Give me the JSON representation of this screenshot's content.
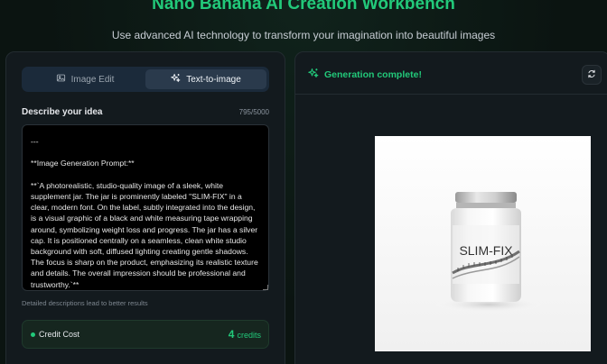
{
  "header": {
    "title": "Nano Banana AI Creation Workbench",
    "subtitle": "Use advanced AI technology to transform your imagination into beautiful images"
  },
  "tabs": [
    {
      "label": "Image Edit",
      "icon": "image-icon",
      "active": false
    },
    {
      "label": "Text-to-image",
      "icon": "sparkles-icon",
      "active": true
    }
  ],
  "prompt": {
    "label": "Describe your idea",
    "char_count": "795/5000",
    "value": "---\n\n**Image Generation Prompt:**\n\n**`A photorealistic, studio-quality image of a sleek, white supplement jar. The jar is prominently labeled \"SLIM-FIX\" in a clear, modern font. On the label, subtly integrated into the design, is a visual graphic of a black and white measuring tape wrapping around, symbolizing weight loss and progress. The jar has a silver cap. It is positioned centrally on a seamless, clean white studio background with soft, diffused lighting creating gentle shadows. The focus is sharp on the product, emphasizing its realistic texture and details. The overall impression should be professional and trustworthy.`**",
    "hint": "Detailed descriptions lead to better results"
  },
  "credit": {
    "label": "Credit Cost",
    "amount": "4",
    "unit": "credits"
  },
  "result": {
    "status": "Generation complete!",
    "status_icon": "sparkles-icon",
    "refresh_icon": "refresh-icon",
    "image_label_text": "SLIM-FIX"
  },
  "colors": {
    "accent": "#22c97a",
    "background": "#0b1411",
    "panel": "#131a1e",
    "tab_active": "#2a3a4c"
  }
}
